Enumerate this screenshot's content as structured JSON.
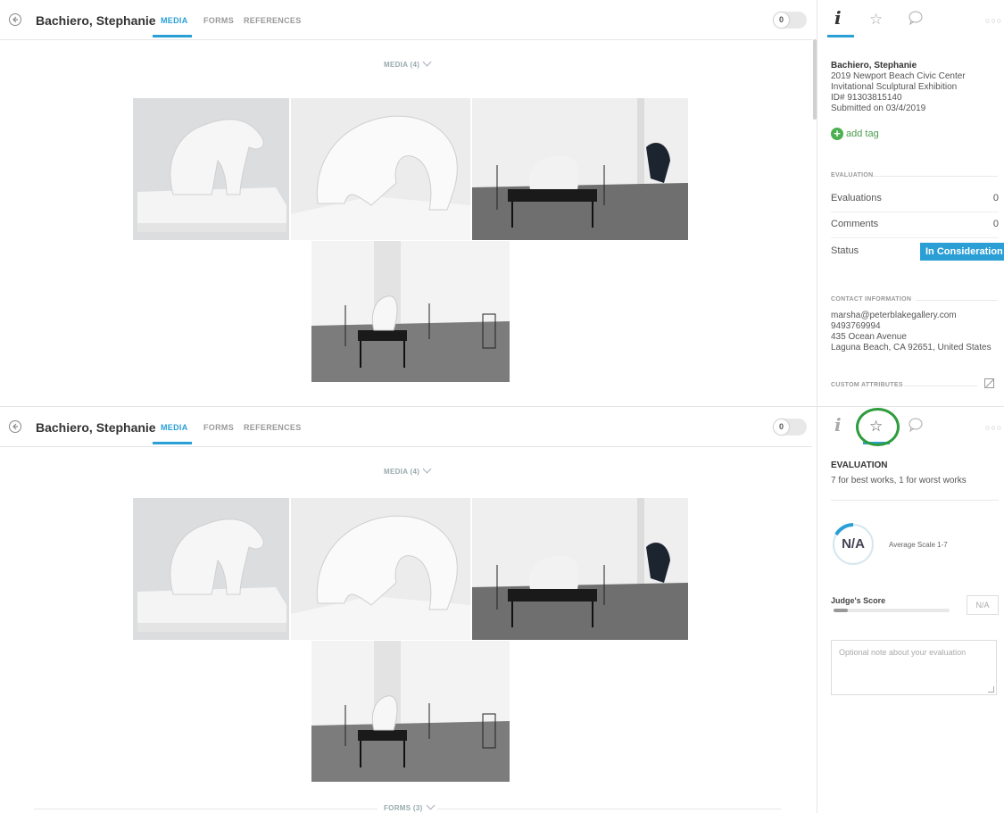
{
  "header": {
    "name": "Bachiero, Stephanie",
    "tabs": [
      {
        "label": "MEDIA",
        "active": true
      },
      {
        "label": "FORMS",
        "active": false
      },
      {
        "label": "REFERENCES",
        "active": false
      }
    ],
    "toggle_value": "0"
  },
  "media": {
    "title": "MEDIA (4)",
    "images": [
      {
        "icon": "sculpture-photo-1"
      },
      {
        "icon": "sculpture-photo-2"
      },
      {
        "icon": "gallery-photo-3"
      },
      {
        "icon": "gallery-photo-4"
      }
    ]
  },
  "forms": {
    "title": "FORMS (3)"
  },
  "sidebar": {
    "icons": [
      "info-icon",
      "star-icon",
      "comment-icon",
      "more-icon"
    ],
    "info": {
      "name": "Bachiero, Stephanie",
      "line1": "2019 Newport Beach Civic Center",
      "line2": "Invitational Sculptural Exhibition",
      "id": "ID# 91303815140",
      "submitted": "Submitted on 03/4/2019"
    },
    "add_tag": "add tag",
    "evaluation_label": "EVALUATION",
    "evaluations_label": "Evaluations",
    "evaluations_value": "0",
    "comments_label": "Comments",
    "comments_value": "0",
    "status_label": "Status",
    "status_value": "In Consideration",
    "contact_label": "CONTACT INFORMATION",
    "contact": {
      "email": "marsha@peterblakegallery.com",
      "phone": "9493769994",
      "address1": "435 Ocean Avenue",
      "address2": "Laguna Beach, CA 92651, United States"
    },
    "custom_label": "CUSTOM ATTRIBUTES"
  },
  "evaluation": {
    "title": "EVALUATION",
    "subtitle": "7 for best works, 1 for worst works",
    "gauge_value": "N/A",
    "average_label": "Average Scale 1-7",
    "judge_label": "Judge's Score",
    "judge_level": 0.12,
    "judge_value": "N/A",
    "note_placeholder": "Optional note about your evaluation"
  },
  "colors": {
    "accent": "#2a9fd6",
    "highlight": "#2e9c3c",
    "add_tag": "#4caf50"
  }
}
